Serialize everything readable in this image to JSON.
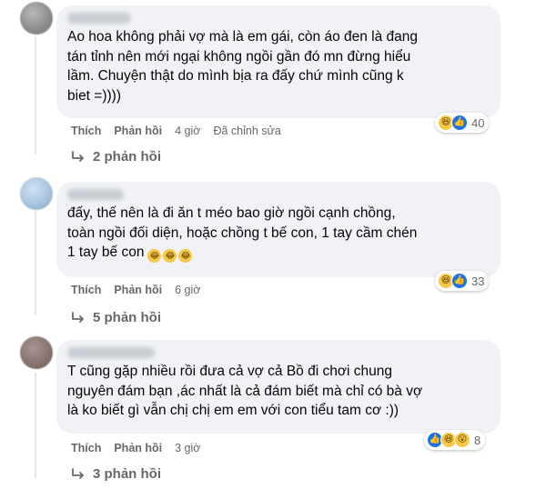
{
  "comments": [
    {
      "text": "Ao hoa không phải vợ mà là em gái, còn áo đen là đang\ntán tỉnh nên mới ngại không ngồi gần đó mn đừng hiểu\nlầm. Chuyện thật do mình bịa ra đấy chứ mình cũng k\nbiet =))))",
      "reaction_count": "40",
      "like_label": "Thích",
      "reply_label": "Phản hồi",
      "time": "4 giờ",
      "edited": "Đã chỉnh sửa",
      "replies_label": "2 phản hồi"
    },
    {
      "text": "đấy, thế nên là đi ăn t méo bao giờ ngồi cạnh chồng,\ntoàn ngồi đối diện, hoặc chồng t bế con, 1 tay cầm chén\n1 tay bế con",
      "reaction_count": "33",
      "like_label": "Thích",
      "reply_label": "Phản hồi",
      "time": "6 giờ",
      "replies_label": "5 phản hồi"
    },
    {
      "text": "T cũng gặp nhiều rồi đưa cả vợ cả Bồ đi chơi chung\nnguyên đám bạn ,ác nhất là cả đám biết mà chỉ có bà vợ\nlà ko biết gì vẫn chị chị em em với con tiểu tam cơ :))",
      "reaction_count": "8",
      "like_label": "Thích",
      "reply_label": "Phản hồi",
      "time": "3 giờ",
      "replies_label": "3 phản hồi"
    }
  ],
  "colors": {
    "bubble": "#f0f2f5",
    "meta": "#65676b",
    "like": "#1b74e4",
    "haha": "#f7c845"
  },
  "icons": [
    "haha-icon",
    "like-icon",
    "wow-icon",
    "reply-arrow-icon"
  ]
}
